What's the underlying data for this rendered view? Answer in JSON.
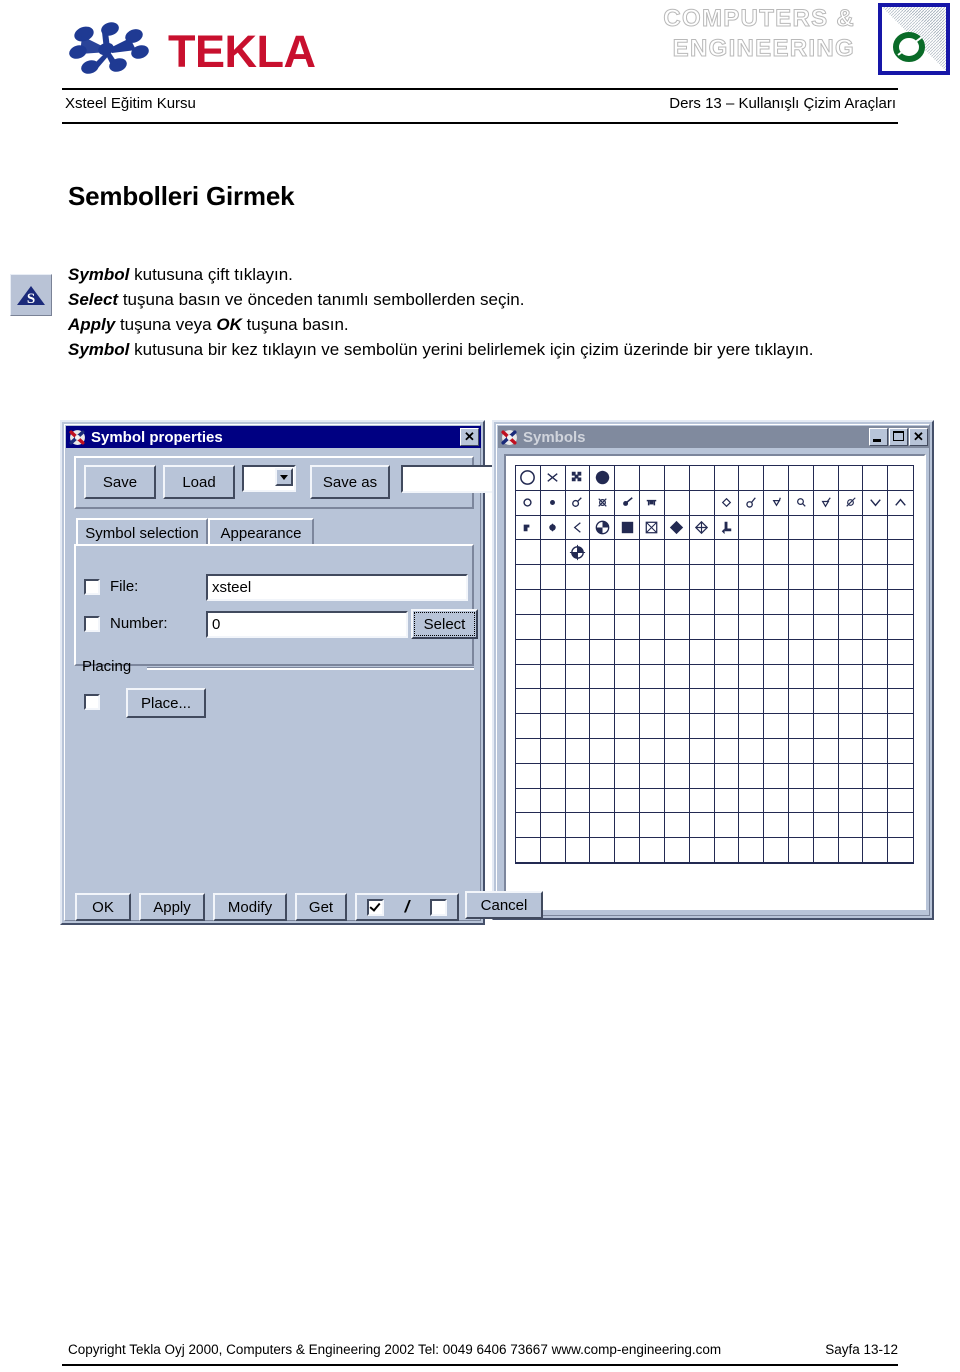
{
  "header": {
    "brand_word": "TEKLA",
    "brand_icon": "tekla-dots-logo",
    "partner_line1": "COMPUTERS &",
    "partner_line2": "ENGINEERING",
    "partner_mark_icon": "ce-circle-mark",
    "left_text": "Xsteel Eğitim Kursu",
    "right_text": "Ders 13  –  Kullanışlı Çizim Araçları"
  },
  "section": {
    "title": "Sembolleri Girmek",
    "note_icon": "symbol-tool-icon",
    "lines": [
      {
        "bold": "Symbol",
        "rest": " kutusuna  çift tıklayın."
      },
      {
        "bold": "Select",
        "rest": " tuşuna basın ve önceden tanımlı sembollerden seçin."
      },
      {
        "bold": "Apply",
        "rest": " tuşuna veya ",
        "bold2": "OK",
        "rest2": " tuşuna basın."
      },
      {
        "bold": "Symbol",
        "rest": " kutusuna bir kez tıklayın ve sembolün yerini belirlemek için çizim üzerinde bir yere tıklayın."
      }
    ]
  },
  "symbol_properties": {
    "title": "Symbol properties",
    "app_icon": "xsteel-app-icon",
    "close_icon": "close-icon",
    "save_label": "Save",
    "load_label": "Load",
    "preset_combo_value": "",
    "save_as_label": "Save as",
    "save_as_value": "",
    "tabs": [
      {
        "label": "Symbol selection",
        "selected": true
      },
      {
        "label": "Appearance",
        "selected": false
      }
    ],
    "file_label": "File:",
    "file_value": "xsteel",
    "file_checked": false,
    "number_label": "Number:",
    "number_value": "0",
    "number_checked": false,
    "select_label": "Select",
    "placing_group_label": "Placing",
    "place_label": "Place...",
    "place_checked": false,
    "buttons": [
      {
        "label": "OK",
        "accel": "O"
      },
      {
        "label": "Apply",
        "accel": "A"
      },
      {
        "label": "Modify",
        "accel": "M"
      },
      {
        "label": "Get",
        "accel": "G"
      }
    ],
    "toggle_on_checked": true,
    "toggle_separator": "/",
    "toggle_off_checked": false,
    "cancel_label": "Cancel",
    "cancel_accel": "C"
  },
  "symbols_window": {
    "title": "Symbols",
    "app_icon": "xsteel-app-icon",
    "minimize_icon": "minimize-icon",
    "maximize_icon": "maximize-icon",
    "close_icon": "close-icon",
    "grid_columns": 16,
    "grid_rows": 16,
    "cells": [
      {
        "r": 0,
        "c": 0,
        "icon": "circle-outline"
      },
      {
        "r": 0,
        "c": 1,
        "icon": "x-mark"
      },
      {
        "r": 0,
        "c": 2,
        "icon": "filled-cluster"
      },
      {
        "r": 0,
        "c": 3,
        "icon": "filled-blob"
      },
      {
        "r": 1,
        "c": 0,
        "icon": "small-circle-outline"
      },
      {
        "r": 1,
        "c": 1,
        "icon": "small-dot"
      },
      {
        "r": 1,
        "c": 2,
        "icon": "marker-stem-a"
      },
      {
        "r": 1,
        "c": 3,
        "icon": "marker-stem-b"
      },
      {
        "r": 1,
        "c": 4,
        "icon": "marker-stem-c"
      },
      {
        "r": 1,
        "c": 5,
        "icon": "marker-stem-d"
      },
      {
        "r": 1,
        "c": 8,
        "icon": "small-diamond-outline"
      },
      {
        "r": 1,
        "c": 9,
        "icon": "marker-tail-a"
      },
      {
        "r": 1,
        "c": 10,
        "icon": "marker-tail-b"
      },
      {
        "r": 1,
        "c": 11,
        "icon": "marker-tail-c"
      },
      {
        "r": 1,
        "c": 12,
        "icon": "marker-tail-d"
      },
      {
        "r": 1,
        "c": 13,
        "icon": "marker-tail-e"
      },
      {
        "r": 1,
        "c": 14,
        "icon": "chevron-down-icon"
      },
      {
        "r": 1,
        "c": 15,
        "icon": "chevron-up-icon"
      },
      {
        "r": 2,
        "c": 0,
        "icon": "small-filled-a"
      },
      {
        "r": 2,
        "c": 1,
        "icon": "small-filled-b"
      },
      {
        "r": 2,
        "c": 2,
        "icon": "less-than-mark"
      },
      {
        "r": 2,
        "c": 3,
        "icon": "compass-rose"
      },
      {
        "r": 2,
        "c": 4,
        "icon": "filled-square"
      },
      {
        "r": 2,
        "c": 5,
        "icon": "square-with-x"
      },
      {
        "r": 2,
        "c": 6,
        "icon": "filled-diamond"
      },
      {
        "r": 2,
        "c": 7,
        "icon": "diamond-with-cross"
      },
      {
        "r": 2,
        "c": 8,
        "icon": "bent-arrow"
      },
      {
        "r": 3,
        "c": 2,
        "icon": "target-rose"
      }
    ]
  },
  "footer": {
    "copyright": "Copyright Tekla Oyj 2000,  Computers & Engineering 2002  Tel: 0049 6406 73667   www.comp-engineering.com",
    "page": "Sayfa 13-12"
  },
  "colors": {
    "brand_red": "#c8102e",
    "brand_blue": "#1f3a93",
    "title_active": "#000082",
    "title_inactive": "#808a9e",
    "dialog_face": "#b8c4d8",
    "symbol_ink": "#232a52"
  }
}
